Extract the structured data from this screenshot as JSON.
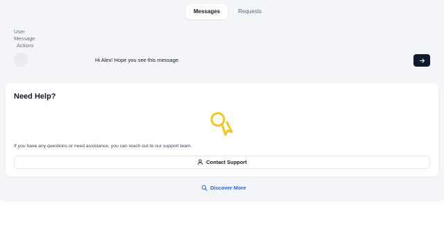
{
  "tabs": [
    {
      "label": "Messages",
      "active": true
    },
    {
      "label": "Requests",
      "active": false
    }
  ],
  "table": {
    "headers": [
      "User",
      "Message",
      "Actions"
    ],
    "rows": [
      {
        "message": "Hi Alex! Hope you see this message."
      }
    ]
  },
  "help": {
    "title": "Need Help?",
    "text": "If you have any questions or need assistance, you can reach out to our support team.",
    "contact_label": "Contact Support",
    "icon": "ribbon-award-icon",
    "icon_color": "#f5c518"
  },
  "discover": {
    "label": "Discover More",
    "color": "#2563eb"
  },
  "colors": {
    "panel_bg": "#f3f5f8",
    "send_button": "#0f1b2d"
  }
}
